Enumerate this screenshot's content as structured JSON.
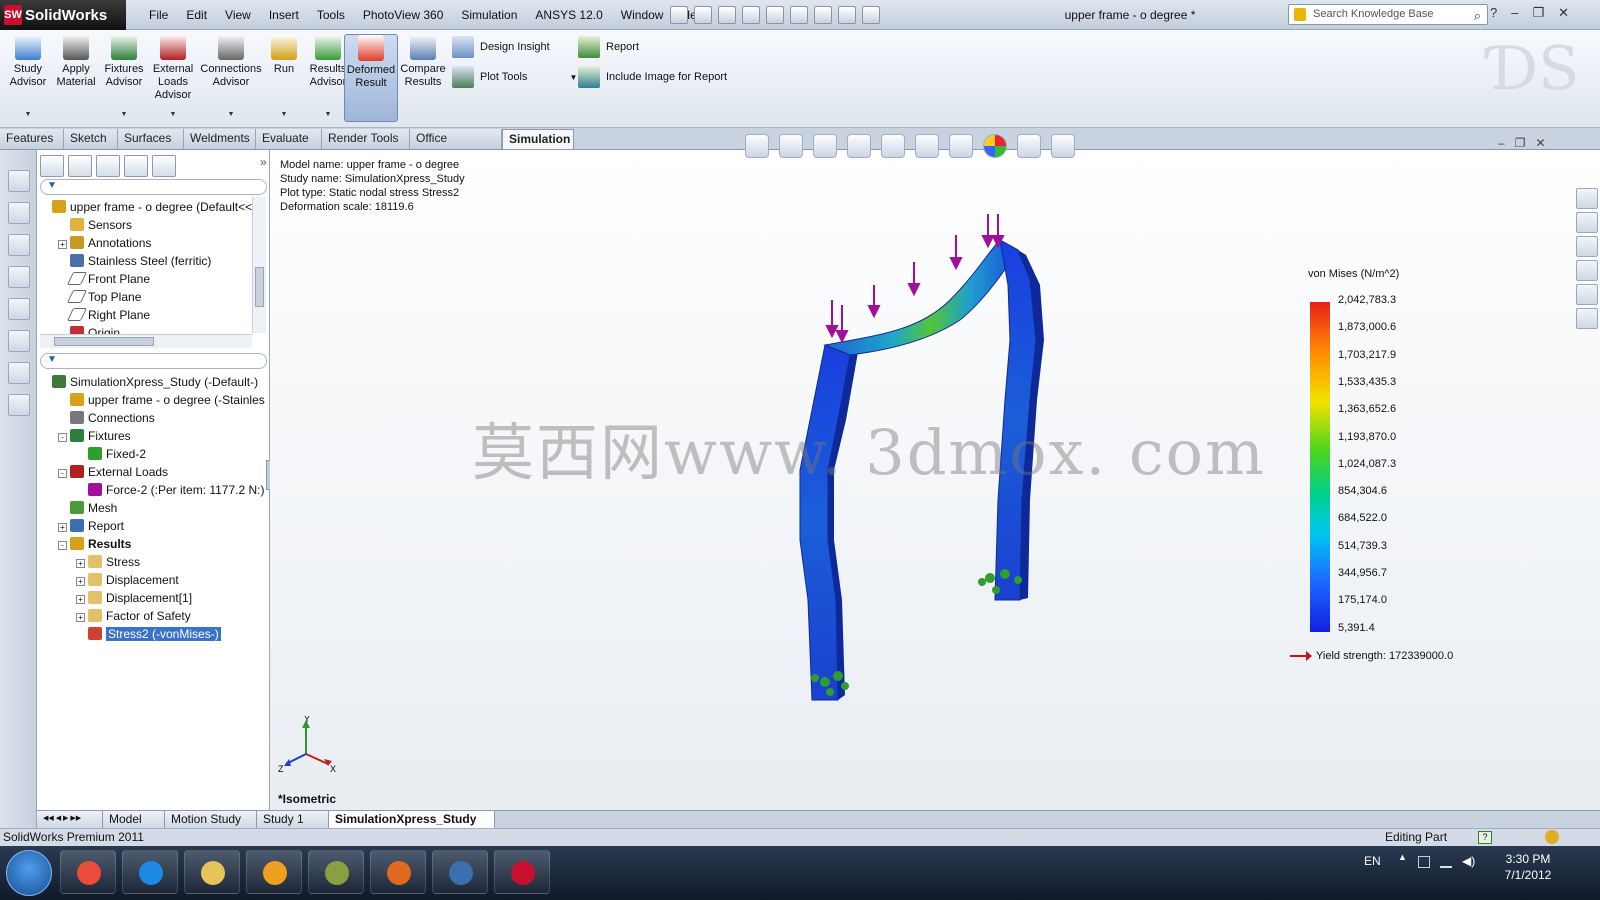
{
  "app": {
    "name": "SolidWorks",
    "logo_letters": "SW",
    "doc_title": "upper frame - o degree *"
  },
  "menu": [
    "File",
    "Edit",
    "View",
    "Insert",
    "Tools",
    "PhotoView 360",
    "Simulation",
    "ANSYS 12.0",
    "Window",
    "Help"
  ],
  "search": {
    "placeholder": "Search Knowledge Base"
  },
  "window_controls": [
    "?",
    "-",
    "restore",
    "x"
  ],
  "ribbon": {
    "buttons": [
      {
        "label": "Study\nAdvisor",
        "icon": "magnifier-icon"
      },
      {
        "label": "Apply\nMaterial",
        "icon": "material-icon"
      },
      {
        "label": "Fixtures\nAdvisor",
        "icon": "fixture-icon"
      },
      {
        "label": "External\nLoads\nAdvisor",
        "icon": "load-icon"
      },
      {
        "label": "Connections\nAdvisor",
        "icon": "connection-icon"
      },
      {
        "label": "Run",
        "icon": "run-icon"
      },
      {
        "label": "Results\nAdvisor",
        "icon": "results-icon"
      },
      {
        "label": "Deformed\nResult",
        "icon": "deformed-icon"
      },
      {
        "label": "Compare\nResults",
        "icon": "compare-icon"
      }
    ],
    "small": [
      "Design Insight",
      "Plot Tools",
      "Report",
      "Include Image for Report"
    ]
  },
  "tabs": [
    "Features",
    "Sketch",
    "Surfaces",
    "Weldments",
    "Evaluate",
    "Render Tools",
    "Office Products",
    "Simulation"
  ],
  "active_tab": "Simulation",
  "feature_tree": [
    {
      "label": "upper frame - o degree  (Default<<D",
      "icon": "part-icon",
      "indent": 0
    },
    {
      "label": "Sensors",
      "icon": "sensor-icon",
      "indent": 1
    },
    {
      "label": "Annotations",
      "icon": "annotation-icon",
      "indent": 1,
      "exp": "+"
    },
    {
      "label": "Stainless Steel (ferritic)",
      "icon": "material-icon",
      "indent": 1
    },
    {
      "label": "Front Plane",
      "icon": "plane-icon",
      "indent": 1
    },
    {
      "label": "Top Plane",
      "icon": "plane-icon",
      "indent": 1
    },
    {
      "label": "Right Plane",
      "icon": "plane-icon",
      "indent": 1
    },
    {
      "label": "Origin",
      "icon": "origin-icon",
      "indent": 1
    }
  ],
  "study_tree": [
    {
      "label": "SimulationXpress_Study (-Default-)",
      "icon": "study-icon",
      "indent": 0
    },
    {
      "label": "upper frame - o degree (-Stainless St",
      "icon": "part-icon",
      "indent": 1
    },
    {
      "label": "Connections",
      "icon": "connection-icon",
      "indent": 1
    },
    {
      "label": "Fixtures",
      "icon": "fixture-icon",
      "indent": 1,
      "exp": "-"
    },
    {
      "label": "Fixed-2",
      "icon": "fixed-icon",
      "indent": 2
    },
    {
      "label": "External Loads",
      "icon": "load-icon",
      "indent": 1,
      "exp": "-"
    },
    {
      "label": "Force-2 (:Per item: 1177.2 N:)",
      "icon": "force-icon",
      "indent": 2
    },
    {
      "label": "Mesh",
      "icon": "mesh-icon",
      "indent": 1
    },
    {
      "label": "Report",
      "icon": "report-icon",
      "indent": 1,
      "exp": "+"
    },
    {
      "label": "Results",
      "icon": "results-folder-icon",
      "indent": 1,
      "exp": "-",
      "bold": true
    },
    {
      "label": "Stress",
      "icon": "folder-icon",
      "indent": 2,
      "exp": "+"
    },
    {
      "label": "Displacement",
      "icon": "folder-icon",
      "indent": 2,
      "exp": "+"
    },
    {
      "label": "Displacement[1]",
      "icon": "folder-icon",
      "indent": 2,
      "exp": "+"
    },
    {
      "label": "Factor of Safety",
      "icon": "folder-icon",
      "indent": 2,
      "exp": "+"
    },
    {
      "label": "Stress2 (-vonMises-)",
      "icon": "plot-icon",
      "indent": 2,
      "selected": true
    }
  ],
  "plot_info": [
    "Model name: upper frame - o degree",
    "Study name: SimulationXpress_Study",
    "Plot type: Static nodal stress Stress2",
    "Deformation scale: 18119.6"
  ],
  "legend": {
    "title": "von Mises (N/m^2)",
    "labels": [
      "2,042,783.3",
      "1,873,000.6",
      "1,703,217.9",
      "1,533,435.3",
      "1,363,652.6",
      "1,193,870.0",
      "1,024,087.3",
      "854,304.6",
      "684,522.0",
      "514,739.3",
      "344,956.7",
      "175,174.0",
      "5,391.4"
    ],
    "yield": "Yield strength: 172339000.0"
  },
  "watermark": "莫西网www. 3dmox. com",
  "view_name": "*Isometric",
  "triad": {
    "x": "X",
    "y": "Y",
    "z": "Z"
  },
  "bottom_tabs": [
    "Model",
    "Motion Study 1",
    "Study 1",
    "SimulationXpress_Study"
  ],
  "active_bottom_tab": "SimulationXpress_Study",
  "status": {
    "left": "SolidWorks Premium 2011",
    "right": "Editing Part"
  },
  "taskbar": {
    "apps": [
      "chrome-icon",
      "ie-icon",
      "explorer-icon",
      "media-icon",
      "app-icon",
      "firefox-icon",
      "kmplayer-icon",
      "solidworks-icon"
    ],
    "lang": "EN",
    "time": "3:30 PM",
    "date": "7/1/2012"
  },
  "colors": {
    "selection": "#3a72c8",
    "load_arrows": "#a0109a",
    "fixture": "#2e9e2e"
  }
}
